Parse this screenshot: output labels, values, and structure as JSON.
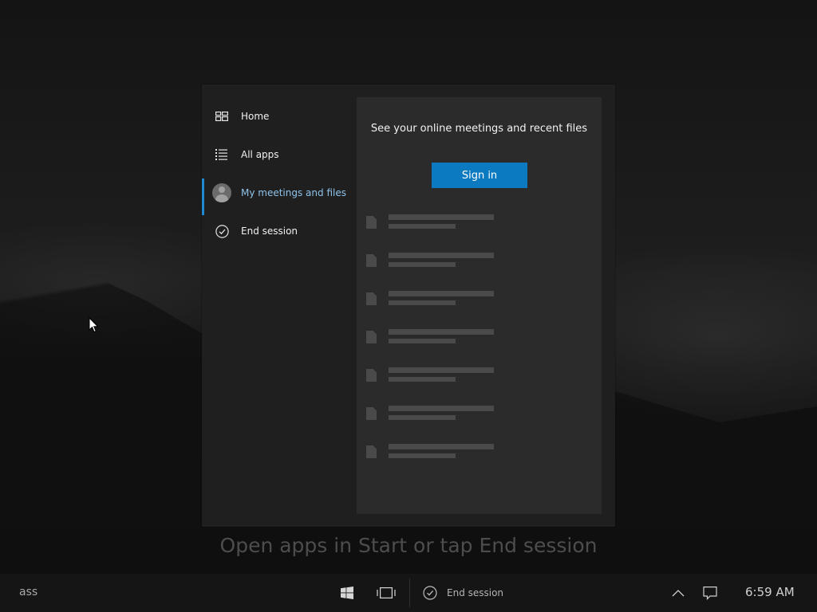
{
  "nav": {
    "items": [
      {
        "label": "Home",
        "icon": "home-grid-icon"
      },
      {
        "label": "All apps",
        "icon": "list-icon"
      },
      {
        "label": "My meetings and files",
        "icon": "avatar-icon",
        "active": true
      },
      {
        "label": "End session",
        "icon": "check-circle-icon"
      }
    ]
  },
  "content": {
    "headline": "See your online meetings and recent files",
    "signin_label": "Sign in",
    "placeholder_rows": 7
  },
  "hint": "Open apps in Start or tap End session",
  "taskbar": {
    "search_text": "ass",
    "end_session_label": "End session",
    "clock": "6:59 AM"
  },
  "colors": {
    "accent": "#1f8ad2",
    "button": "#0b7ac0",
    "active_text": "#8fc3ea"
  }
}
